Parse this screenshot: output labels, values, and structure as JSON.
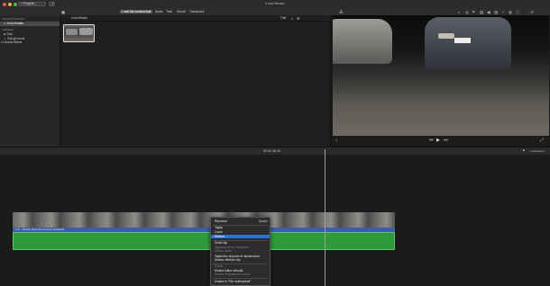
{
  "window": {
    "title": "Il mio filmato",
    "projects_button": "< Progetti"
  },
  "toolbar": {
    "tabs": [
      {
        "label": "I miei file multimediali",
        "active": true
      },
      {
        "label": "Audio",
        "active": false
      },
      {
        "label": "Titoli",
        "active": false
      },
      {
        "label": "Sfondi",
        "active": false
      },
      {
        "label": "Transizioni",
        "active": false
      }
    ]
  },
  "sidebar": {
    "section_project": "PROGETTO/MEDIA",
    "project_item": "Il mio filmato",
    "section_libraries": "LIBRERIE",
    "library_items": [
      "Foto",
      "Tutti gli eventi",
      "Libreria iMovie"
    ]
  },
  "browser": {
    "header_label": "Il mio filmato",
    "filter_label": "Tutti"
  },
  "timeline": {
    "timecode": "00:15 / 00:16",
    "settings_label": "Impostazioni",
    "audio_clip_label": "1.0s – Filmato: Suoni che si trova in Sottofondo"
  },
  "context_menu": {
    "header": "Riproduci",
    "header_right": "Spazio",
    "items": [
      {
        "label": "Taglia",
        "disabled": false,
        "highlighted": false
      },
      {
        "label": "Copia",
        "disabled": false,
        "highlighted": false
      },
      {
        "label": "Elimina",
        "disabled": false,
        "highlighted": true
      },
      {
        "label": "Dividi clip",
        "disabled": false,
        "highlighted": false
      },
      {
        "label": "Aggiungi fermo immagine",
        "disabled": true,
        "highlighted": false
      },
      {
        "label": "Stacca audio",
        "disabled": true,
        "highlighted": false
      },
      {
        "label": "Taglia fino al punto di riproduzione",
        "disabled": false,
        "highlighted": false
      },
      {
        "label": "Mostra rifinitore clip",
        "disabled": false,
        "highlighted": false
      },
      {
        "label": "Rivela",
        "disabled": true,
        "highlighted": false
      },
      {
        "label": "Mostra editor velocità",
        "disabled": false,
        "highlighted": false
      },
      {
        "label": "Mostra Regolazione tracce",
        "disabled": true,
        "highlighted": false
      },
      {
        "label": "Mostra in \"File multimediali\"",
        "disabled": false,
        "highlighted": false
      }
    ]
  },
  "colors": {
    "accent": "#2f6fd6",
    "audio_track": "#2f9a3a",
    "title_bar": "#2b2b2b"
  }
}
